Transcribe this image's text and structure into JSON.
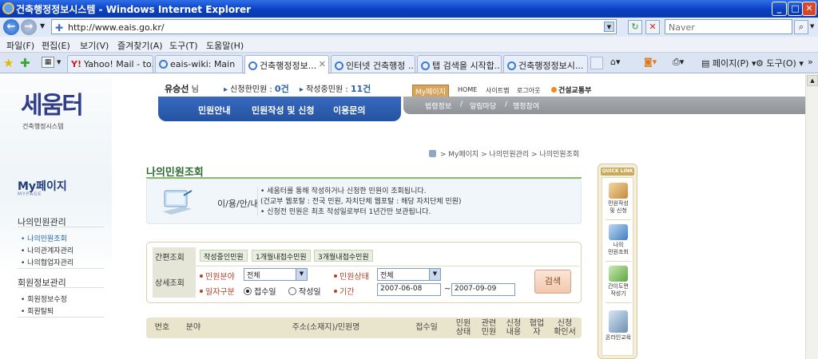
{
  "window": {
    "title": "건축행정정보시스템 - Windows Internet Explorer"
  },
  "address": {
    "url": "http://www.eais.go.kr/",
    "search_placeholder": "Naver"
  },
  "menu": [
    "파일(F)",
    "편집(E)",
    "보기(V)",
    "즐겨찾기(A)",
    "도구(T)",
    "도움말(H)"
  ],
  "tabs": [
    {
      "label": "Yahoo! Mail - to..."
    },
    {
      "label": "eais-wiki: Main"
    },
    {
      "label": "건축행정정보..."
    },
    {
      "label": "인터넷 건축행정 ..."
    },
    {
      "label": "탭 검색을 시작합..."
    },
    {
      "label": "건축행정정보시..."
    }
  ],
  "toolbar": {
    "page": "페이지(P)",
    "tools": "도구(O)"
  },
  "site": {
    "logo_text": "세움터",
    "logo_sub": "건축행정시스템",
    "user_name": "유승선",
    "user_suffix": "님",
    "applied_label": "신청한민원 :",
    "applied_count": "0건",
    "writing_label": "작성중민원 :",
    "writing_count": "11건",
    "mypage_btn": "My페이지",
    "top_links": [
      "HOME",
      "사이트맵",
      "로그아웃"
    ],
    "ministry": "건설교통부",
    "main_nav": [
      "민원안내",
      "민원작성 및 신청",
      "이용문의"
    ],
    "sub_nav": [
      "법령정보",
      "/",
      "알림마당",
      "/",
      "행정참여"
    ]
  },
  "sidebar": {
    "title": "My페이지",
    "subtitle": "MYPAGE",
    "section1": "나의민원관리",
    "items1": [
      "• 나의민원조회",
      "• 나의관계자관리",
      "• 나의협업자관리"
    ],
    "section2": "회원정보관리",
    "items2": [
      "• 회원정보수정",
      "• 회원탈퇴"
    ]
  },
  "breadcrumb": [
    "> My페이지",
    "> 나의민원관리",
    "> 나의민원조회"
  ],
  "page_title": "나의민원조회",
  "notice": {
    "label": "이/용/안/내",
    "lines": [
      "• 세움터를 통해 작성하거나 신청한 민원이 조회됩니다.",
      "  (건교부 웹포탈 : 전국 민원, 자치단체 웹포탈 : 해당 자치단체 민원)",
      "• 신청전 민원은 최초 작성일로부터 1년간만 보관됩니다."
    ]
  },
  "search": {
    "quick_label": "간편조회",
    "quick_buttons": [
      "작성중인민원",
      "1개월내접수민원",
      "3개월내접수민원"
    ],
    "detail_label": "상세조회",
    "field_label": "민원분야",
    "field_value": "전체",
    "status_label": "민원상태",
    "status_value": "전체",
    "date_type_label": "일자구분",
    "radio1": "접수일",
    "radio2": "작성일",
    "period_label": "기간",
    "date_from": "2007-06-08",
    "date_sep": "~",
    "date_to": "2007-09-09",
    "lookup_button": "검색"
  },
  "results_header": [
    "번호",
    "분야",
    "주소(소재지)/민원명",
    "접수일",
    "민원\n상태",
    "관련\n민원",
    "신청\n내용",
    "협업\n자",
    "신청\n확인서"
  ],
  "quick_link": {
    "title": "QUICK LINK",
    "items": [
      "민원작성\n및 신청",
      "나의\n민원조회",
      "간이도면\n작성기",
      "온라인교육"
    ]
  }
}
